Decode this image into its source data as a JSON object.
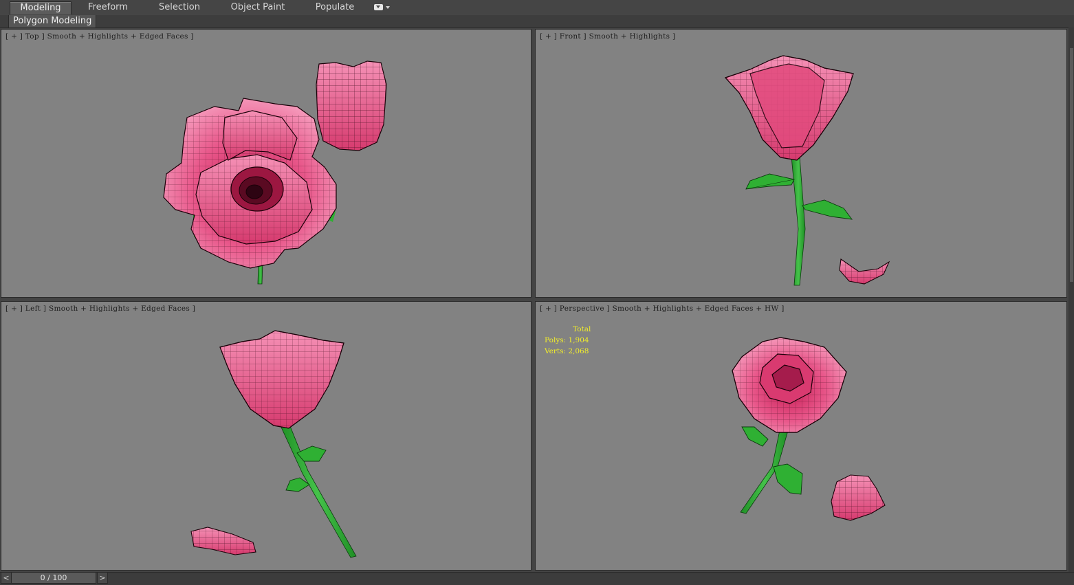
{
  "ribbon": {
    "tabs": [
      "Modeling",
      "Freeform",
      "Selection",
      "Object Paint",
      "Populate"
    ],
    "active_tab": "Modeling",
    "panel_label": "Polygon Modeling"
  },
  "viewports": {
    "top": {
      "label": "[ + ] Top ] Smooth + Highlights + Edged Faces ]"
    },
    "front": {
      "label": "[ + ] Front ] Smooth + Highlights ]"
    },
    "left": {
      "label": "[ + ] Left ] Smooth + Highlights + Edged Faces ]"
    },
    "perspective": {
      "label": "[ + ] Perspective ] Smooth + Highlights + Edged Faces + HW ]"
    }
  },
  "stats": {
    "total_label": "Total",
    "polys": "Polys: 1,904",
    "verts": "Verts: 2,068"
  },
  "timeline": {
    "prev": "<",
    "next": ">",
    "frame": "0 / 100"
  },
  "colors": {
    "viewport_bg": "#828282",
    "petal": "#e85a8a",
    "stem": "#2fb033",
    "stats_text": "#f2ee2a"
  },
  "icons": [
    "ribbon-options-icon"
  ]
}
